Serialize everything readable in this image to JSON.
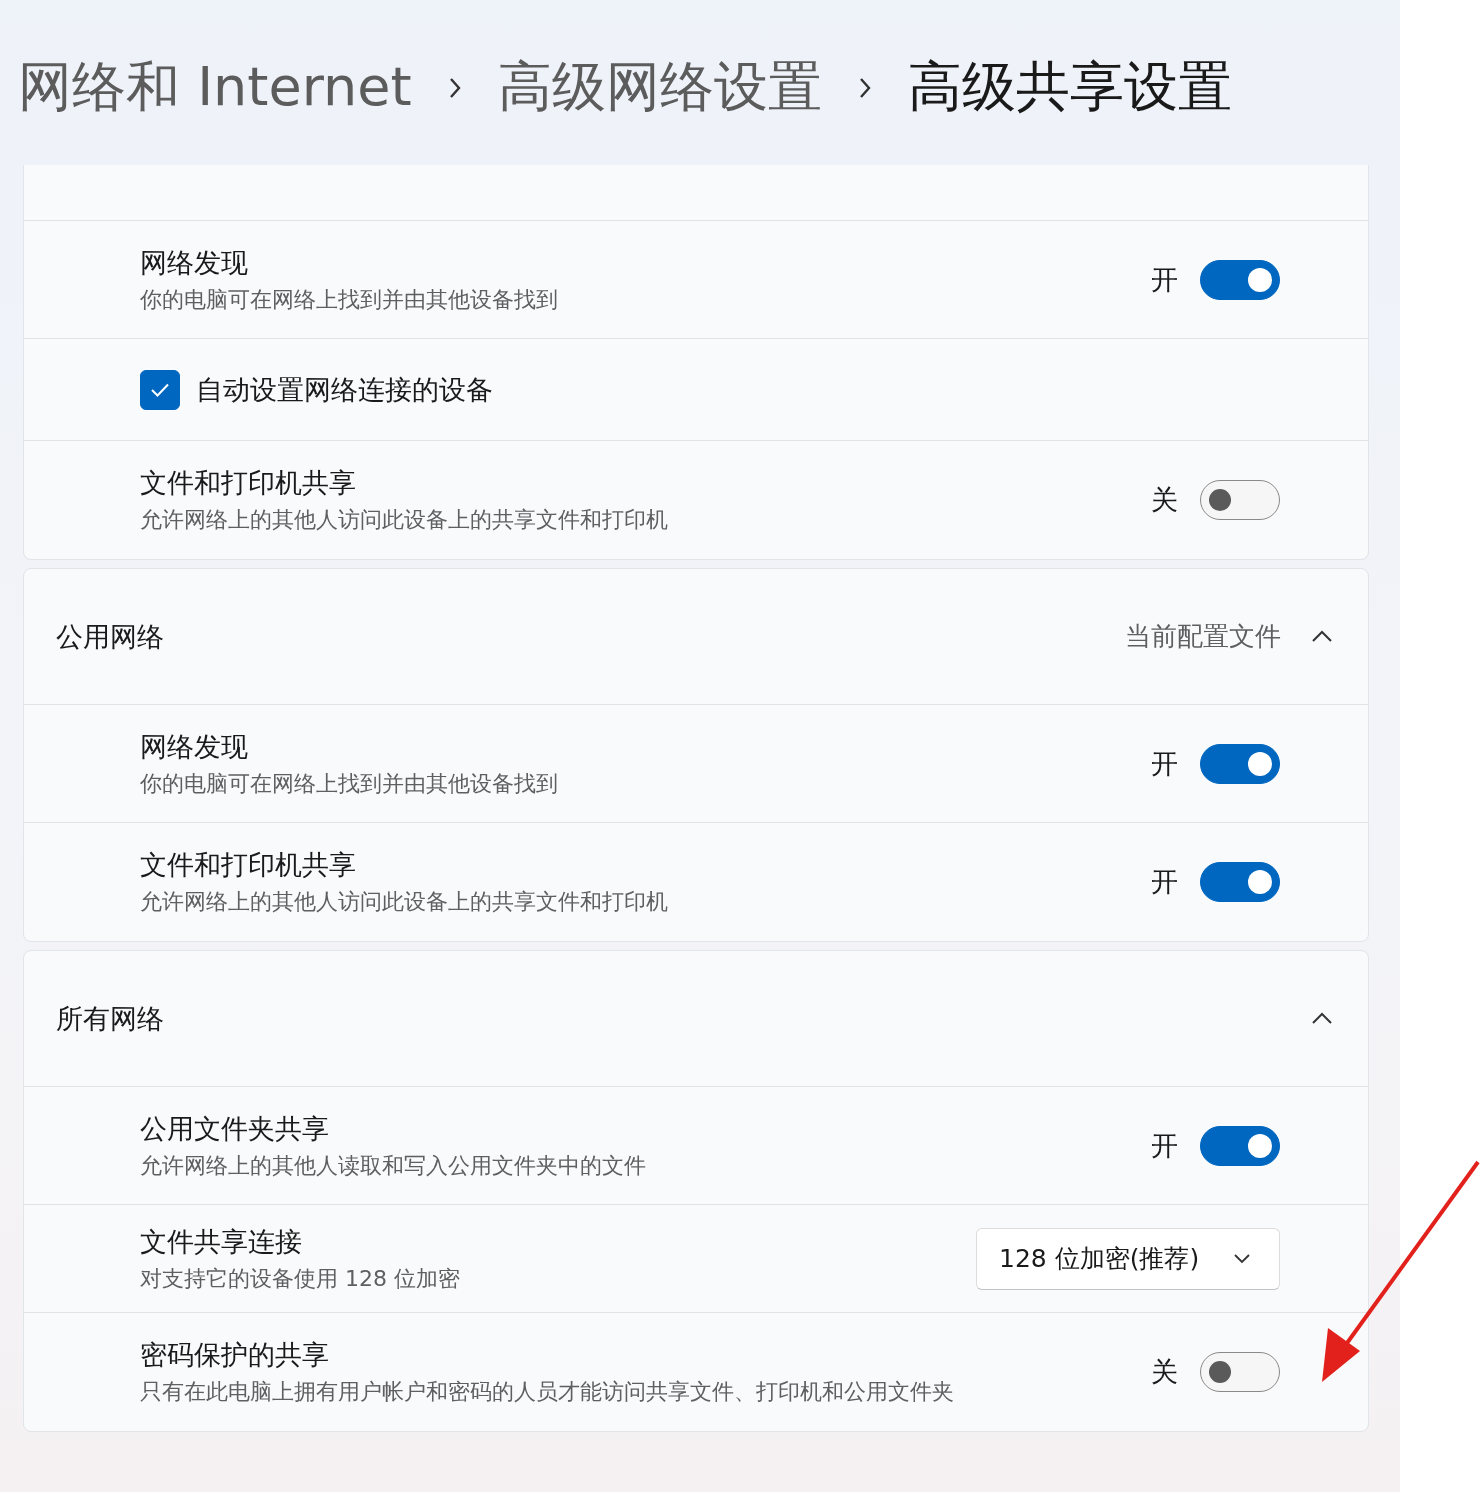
{
  "breadcrumb": [
    {
      "text": "网络和 Internet",
      "current": false
    },
    {
      "text": "高级网络设置",
      "current": false
    },
    {
      "text": "高级共享设置",
      "current": true
    }
  ],
  "sections": [
    {
      "rows": [
        {
          "kind": "toggle",
          "title": "网络发现",
          "description": "你的电脑可在网络上找到并由其他设备找到",
          "on": true,
          "state_label": "开"
        },
        {
          "kind": "checkbox",
          "label": "自动设置网络连接的设备",
          "checked": true
        },
        {
          "kind": "toggle",
          "title": "文件和打印机共享",
          "description": "允许网络上的其他人访问此设备上的共享文件和打印机",
          "on": false,
          "state_label": "关"
        }
      ]
    },
    {
      "header": {
        "title": "公用网络",
        "status": "当前配置文件",
        "expanded": true
      },
      "rows": [
        {
          "kind": "toggle",
          "title": "网络发现",
          "description": "你的电脑可在网络上找到并由其他设备找到",
          "on": true,
          "state_label": "开"
        },
        {
          "kind": "toggle",
          "title": "文件和打印机共享",
          "description": "允许网络上的其他人访问此设备上的共享文件和打印机",
          "on": true,
          "state_label": "开"
        }
      ]
    },
    {
      "header": {
        "title": "所有网络",
        "expanded": true
      },
      "rows": [
        {
          "kind": "toggle",
          "title": "公用文件夹共享",
          "description": "允许网络上的其他人读取和写入公用文件夹中的文件",
          "on": true,
          "state_label": "开"
        },
        {
          "kind": "dropdown",
          "title": "文件共享连接",
          "description": "对支持它的设备使用 128 位加密",
          "value": "128 位加密(推荐)"
        },
        {
          "kind": "toggle",
          "title": "密码保护的共享",
          "description": "只有在此电脑上拥有用户帐户和密码的人员才能访问共享文件、打印机和公用文件夹",
          "on": false,
          "state_label": "关"
        }
      ]
    }
  ],
  "annotations": [
    {
      "kind": "arrow",
      "color": "#e3211c"
    }
  ]
}
